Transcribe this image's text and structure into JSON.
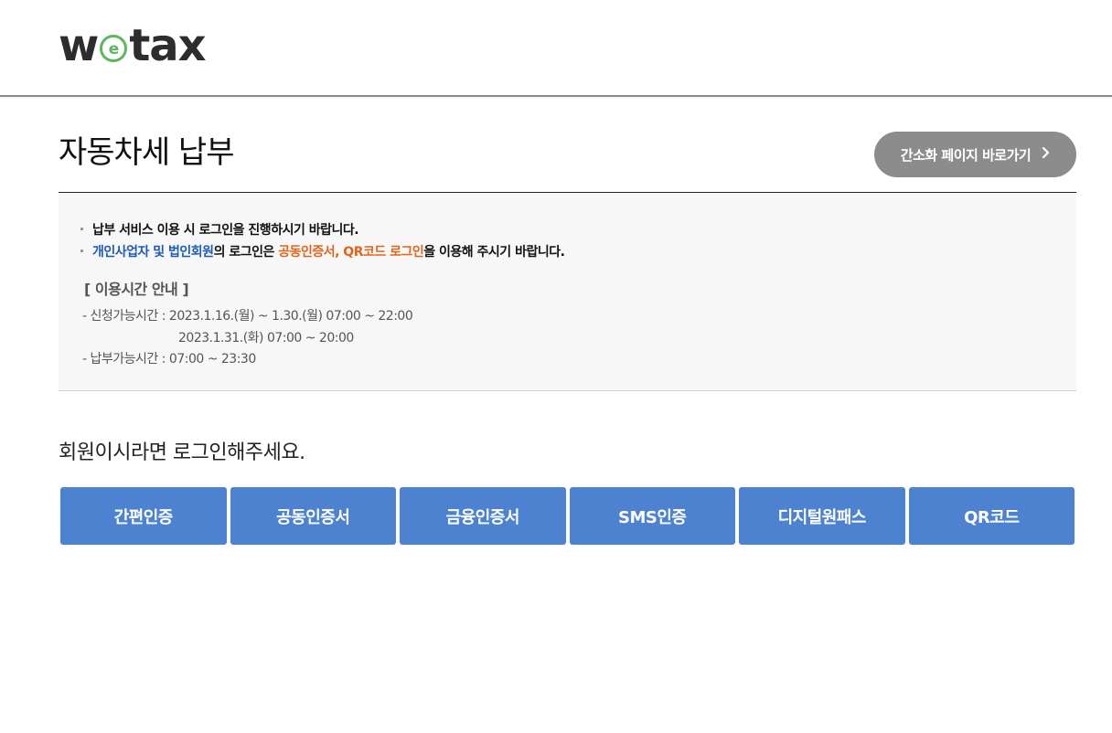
{
  "header": {
    "logo_left": "w",
    "logo_right": "tax"
  },
  "page": {
    "title": "자동차세 납부",
    "simple_page_button": "간소화 페이지 바로가기"
  },
  "notice": {
    "line1": "납부 서비스 이용 시 로그인을 진행하시기 바랍니다.",
    "line2_blue": "개인사업자 및 법인회원",
    "line2_mid": "의 로그인은 ",
    "line2_orange": "공동인증서, QR코드 로그인",
    "line2_end": "을 이용해 주시기 바랍니다."
  },
  "hours": {
    "title": "[ 이용시간 안내 ]",
    "apply_label": "- 신청가능시간 : ",
    "apply_line1": "2023.1.16.(월) ~ 1.30.(월) 07:00 ~ 22:00",
    "apply_line2": "2023.1.31.(화) 07:00 ~ 20:00",
    "pay_label": "- 납부가능시간 : ",
    "pay_value": "07:00 ~ 23:30"
  },
  "login": {
    "message": "회원이시라면 로그인해주세요.",
    "buttons": [
      "간편인증",
      "공동인증서",
      "금융인증서",
      "SMS인증",
      "디지털원패스",
      "QR코드"
    ]
  },
  "colors": {
    "brand_green": "#5cb85c",
    "auth_button": "#4d82d0",
    "simple_button": "#8c8c8c",
    "highlight_blue": "#1c5bb8",
    "highlight_orange": "#e0651c"
  }
}
